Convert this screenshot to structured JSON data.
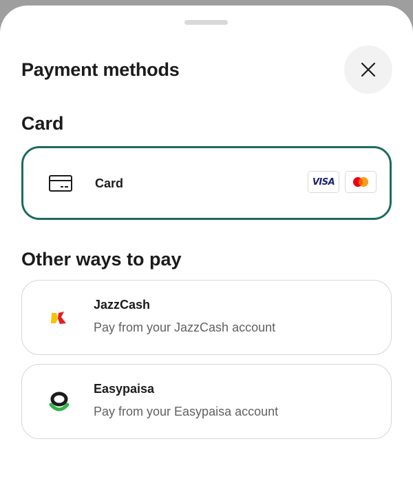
{
  "sheet": {
    "title": "Payment methods"
  },
  "icons": {
    "close": "close-icon",
    "card": "credit-card-icon",
    "jazzcash": "jazzcash-logo-icon",
    "easypaisa": "easypaisa-logo-icon",
    "visa": "visa-logo-icon",
    "mastercard": "mastercard-logo-icon"
  },
  "sections": {
    "card": {
      "title": "Card",
      "option": {
        "label": "Card",
        "brands": [
          "VISA",
          "Mastercard"
        ],
        "selected": true
      }
    },
    "other": {
      "title": "Other ways to pay",
      "options": [
        {
          "label": "JazzCash",
          "description": "Pay from your JazzCash account"
        },
        {
          "label": "Easypaisa",
          "description": "Pay from your Easypaisa account"
        }
      ]
    }
  },
  "colors": {
    "selected_border": "#1d6b5b",
    "visa_blue": "#1a1f71",
    "mastercard_red": "#eb001b",
    "mastercard_orange": "#f79e1b",
    "easypaisa_green": "#2fb34a",
    "jazzcash_red": "#e31e24",
    "jazzcash_yellow": "#f6c500"
  }
}
